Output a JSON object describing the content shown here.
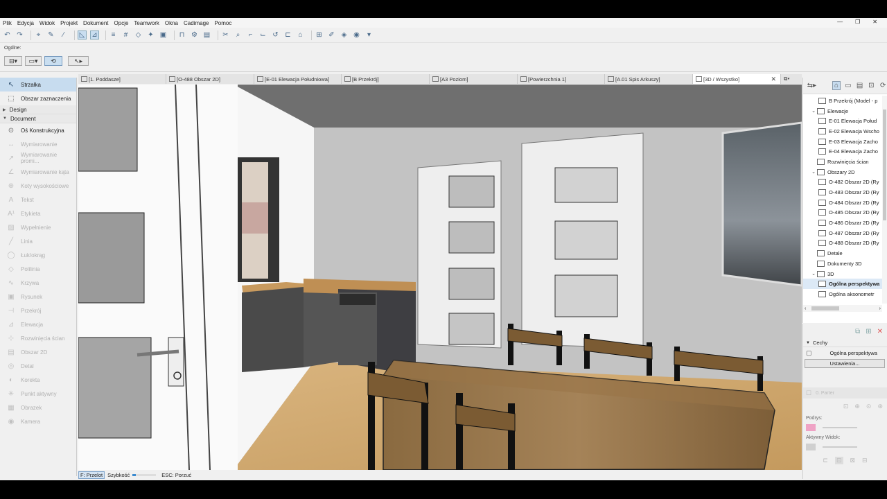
{
  "menu": [
    "Plik",
    "Edycja",
    "Widok",
    "Projekt",
    "Dokument",
    "Opcje",
    "Teamwork",
    "Okna",
    "Cadimage",
    "Pomoc"
  ],
  "window_controls": [
    "—",
    "❐",
    "✕"
  ],
  "info_box": {
    "label": "Ogólne:"
  },
  "toolbox": {
    "arrow": "Strzałka",
    "marquee": "Obszar zaznaczenia",
    "groups": {
      "design": "Design",
      "document": "Document"
    },
    "document_tools": [
      {
        "label": "Oś Konstrukcyjna",
        "enabled": true,
        "icon": "axis-icon"
      },
      {
        "label": "Wymiarowanie",
        "enabled": false,
        "icon": "dimension-icon"
      },
      {
        "label": "Wymiarowanie promi...",
        "enabled": false,
        "icon": "radial-dimension-icon"
      },
      {
        "label": "Wymiarowanie kąta",
        "enabled": false,
        "icon": "angle-dimension-icon"
      },
      {
        "label": "Koty wysokościowe",
        "enabled": false,
        "icon": "level-dimension-icon"
      },
      {
        "label": "Tekst",
        "enabled": false,
        "icon": "text-icon"
      },
      {
        "label": "Etykieta",
        "enabled": false,
        "icon": "label-icon"
      },
      {
        "label": "Wypełnienie",
        "enabled": false,
        "icon": "fill-icon"
      },
      {
        "label": "Linia",
        "enabled": false,
        "icon": "line-icon"
      },
      {
        "label": "Łuk/okrąg",
        "enabled": false,
        "icon": "arc-icon"
      },
      {
        "label": "Polilinia",
        "enabled": false,
        "icon": "polyline-icon"
      },
      {
        "label": "Krzywa",
        "enabled": false,
        "icon": "spline-icon"
      },
      {
        "label": "Rysunek",
        "enabled": false,
        "icon": "drawing-icon"
      },
      {
        "label": "Przekrój",
        "enabled": false,
        "icon": "section-icon"
      },
      {
        "label": "Elewacja",
        "enabled": false,
        "icon": "elevation-icon"
      },
      {
        "label": "Rozwinięcia ścian",
        "enabled": false,
        "icon": "interior-elevation-icon"
      },
      {
        "label": "Obszar 2D",
        "enabled": false,
        "icon": "worksheet-icon"
      },
      {
        "label": "Detal",
        "enabled": false,
        "icon": "detail-icon"
      },
      {
        "label": "Korekta",
        "enabled": false,
        "icon": "change-icon"
      },
      {
        "label": "Punkt aktywny",
        "enabled": false,
        "icon": "hotspot-icon"
      },
      {
        "label": "Obrazek",
        "enabled": false,
        "icon": "image-icon"
      },
      {
        "label": "Kamera",
        "enabled": false,
        "icon": "camera-icon"
      }
    ]
  },
  "tabs": [
    {
      "label": "[1. Poddasze]"
    },
    {
      "label": "[O-488 Obszar 2D]"
    },
    {
      "label": "[E-01 Elewacja Południowa]"
    },
    {
      "label": "[B Przekrój]"
    },
    {
      "label": "[A3 Poziom]"
    },
    {
      "label": "[Powierzchnia 1]"
    },
    {
      "label": "[A.01 Spis Arkuszy]"
    },
    {
      "label": "[3D / Wszystko]",
      "active": true
    }
  ],
  "status": {
    "mode": "F: Przelot",
    "speed_label": "Szybkość",
    "speed_level": 0.15,
    "esc": "ESC: Porzuć"
  },
  "navigator": {
    "items": [
      {
        "label": "B Przekrój (Model - p",
        "indent": 2,
        "expand": ""
      },
      {
        "label": "Elewacje",
        "indent": 1,
        "expand": "v"
      },
      {
        "label": "E-01 Elewacja Połud",
        "indent": 2,
        "expand": ""
      },
      {
        "label": "E-02 Elewacja Wscho",
        "indent": 2,
        "expand": ""
      },
      {
        "label": "E-03 Elewacja Zacho",
        "indent": 2,
        "expand": ""
      },
      {
        "label": "E-04 Elewacja Zacho",
        "indent": 2,
        "expand": ""
      },
      {
        "label": "Rozwinięcia ścian",
        "indent": 1,
        "expand": ""
      },
      {
        "label": "Obszary 2D",
        "indent": 1,
        "expand": "v"
      },
      {
        "label": "O-482 Obszar 2D (Ry",
        "indent": 2,
        "expand": ""
      },
      {
        "label": "O-483 Obszar 2D (Ry",
        "indent": 2,
        "expand": ""
      },
      {
        "label": "O-484 Obszar 2D (Ry",
        "indent": 2,
        "expand": ""
      },
      {
        "label": "O-485 Obszar 2D (Ry",
        "indent": 2,
        "expand": ""
      },
      {
        "label": "O-486 Obszar 2D (Ry",
        "indent": 2,
        "expand": ""
      },
      {
        "label": "O-487 Obszar 2D (Ry",
        "indent": 2,
        "expand": ""
      },
      {
        "label": "O-488 Obszar 2D (Ry",
        "indent": 2,
        "expand": ""
      },
      {
        "label": "Detale",
        "indent": 1,
        "expand": ""
      },
      {
        "label": "Dokumenty 3D",
        "indent": 1,
        "expand": ""
      },
      {
        "label": "3D",
        "indent": 1,
        "expand": "v"
      },
      {
        "label": "Ogólna perspektywa",
        "indent": 2,
        "expand": "",
        "selected": true
      },
      {
        "label": "Ogólna aksonometr",
        "indent": 2,
        "expand": ""
      }
    ]
  },
  "properties": {
    "header": "Cechy",
    "view_name": "Ogólna perspektywa",
    "settings_button": "Ustawienia...",
    "layer_field": "0. Parter",
    "underlay_label": "Podrys:",
    "active_view_label": "Aktywny Widok:"
  }
}
